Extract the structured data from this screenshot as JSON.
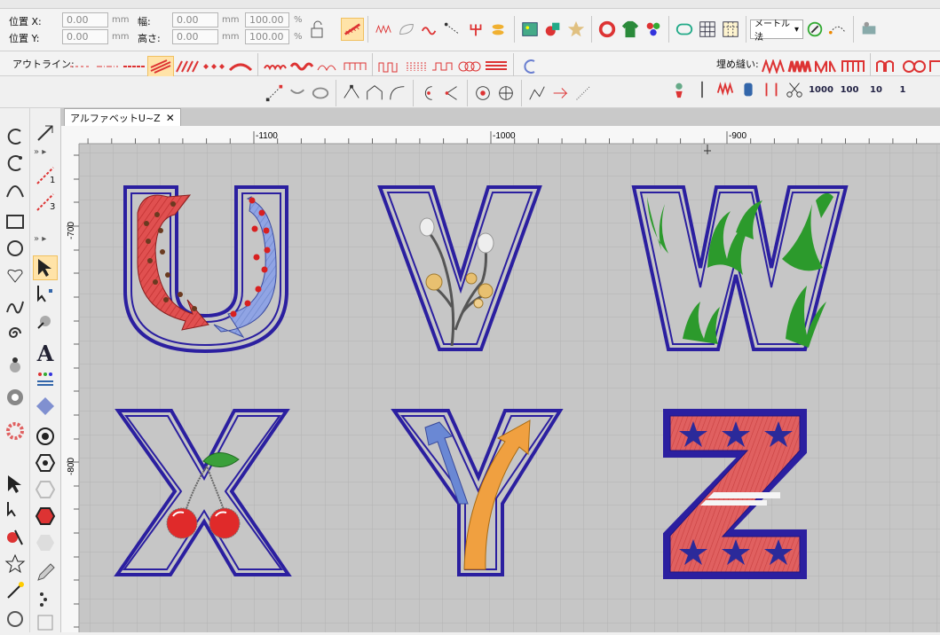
{
  "toolbar": {
    "pos_x_label": "位置 X:",
    "pos_y_label": "位置 Y:",
    "pos_x_value": "0.00",
    "pos_y_value": "0.00",
    "width_label": "幅:",
    "height_label": "高さ:",
    "width_value": "0.00",
    "height_value": "0.00",
    "scale_w_value": "100.00",
    "scale_h_value": "100.00",
    "unit_mm": "mm",
    "unit_pct": "%",
    "outline_label": "アウトライン:",
    "fill_label": "埋め縫い:",
    "method_select": "メートル法",
    "density_values": [
      "1000",
      "100",
      "10",
      "1"
    ]
  },
  "document": {
    "tab_title": "アルファベットU~Z",
    "close_glyph": "✕"
  },
  "ruler": {
    "h_labels": [
      "-1100",
      "-1000",
      "-900"
    ],
    "v_labels": [
      "-700",
      "-800"
    ]
  },
  "lefttools": {
    "text_tool": "A",
    "stepper_1": "1",
    "stepper_3": "3"
  },
  "letters": [
    "U",
    "V",
    "W",
    "X",
    "Y",
    "Z"
  ],
  "colors": {
    "outline": "#2b1fa0",
    "canvas_bg": "#c9c9c9",
    "grid": "#b3b3b3",
    "red": "#e04848",
    "blue_fill": "#8aa0e0",
    "green": "#2c9a2c",
    "orange": "#f0a040",
    "selected_bg": "#ffe3a8"
  }
}
